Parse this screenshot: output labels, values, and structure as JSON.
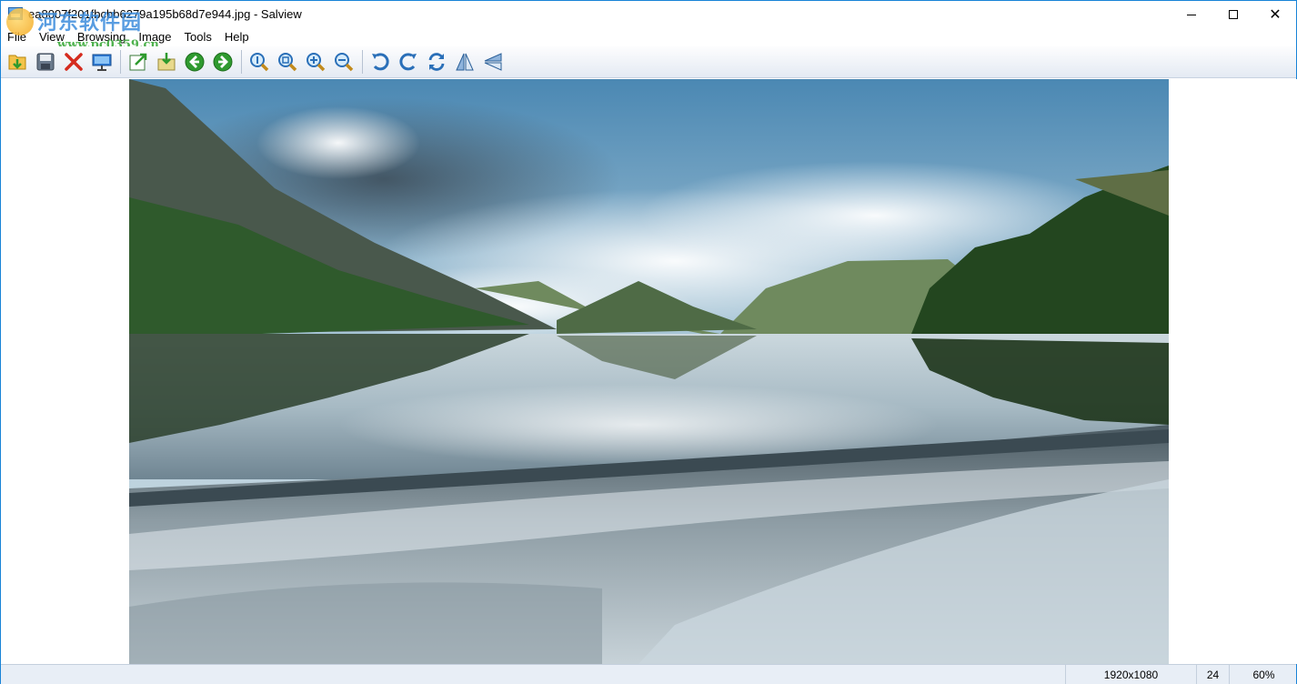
{
  "window": {
    "title": "ea8007f201fbcbb6279a195b68d7e944.jpg - Salview",
    "controls": {
      "minimize": "minimize-icon",
      "maximize": "maximize-icon",
      "close": "close-icon"
    }
  },
  "watermark": {
    "main": "河东软件园",
    "url": "www.pc0359.cn"
  },
  "menu": [
    "File",
    "View",
    "Browsing",
    "Image",
    "Tools",
    "Help"
  ],
  "toolbar": {
    "groups": [
      [
        "open-icon",
        "save-icon",
        "delete-icon",
        "slideshow-icon"
      ],
      [
        "export-icon",
        "import-icon",
        "previous-icon",
        "next-icon"
      ],
      [
        "actual-size-icon",
        "fit-icon",
        "zoom-in-icon",
        "zoom-out-icon"
      ],
      [
        "rotate-left-icon",
        "rotate-right-icon",
        "rotate-icon",
        "flip-horizontal-icon",
        "flip-vertical-icon"
      ]
    ]
  },
  "status": {
    "resolution": "1920x1080",
    "bit_depth": "24",
    "zoom": "60%"
  },
  "colors": {
    "accent": "#1883d7",
    "toolbar_bg": "#e4eaf3",
    "statusbar_bg": "#e8eef6"
  }
}
